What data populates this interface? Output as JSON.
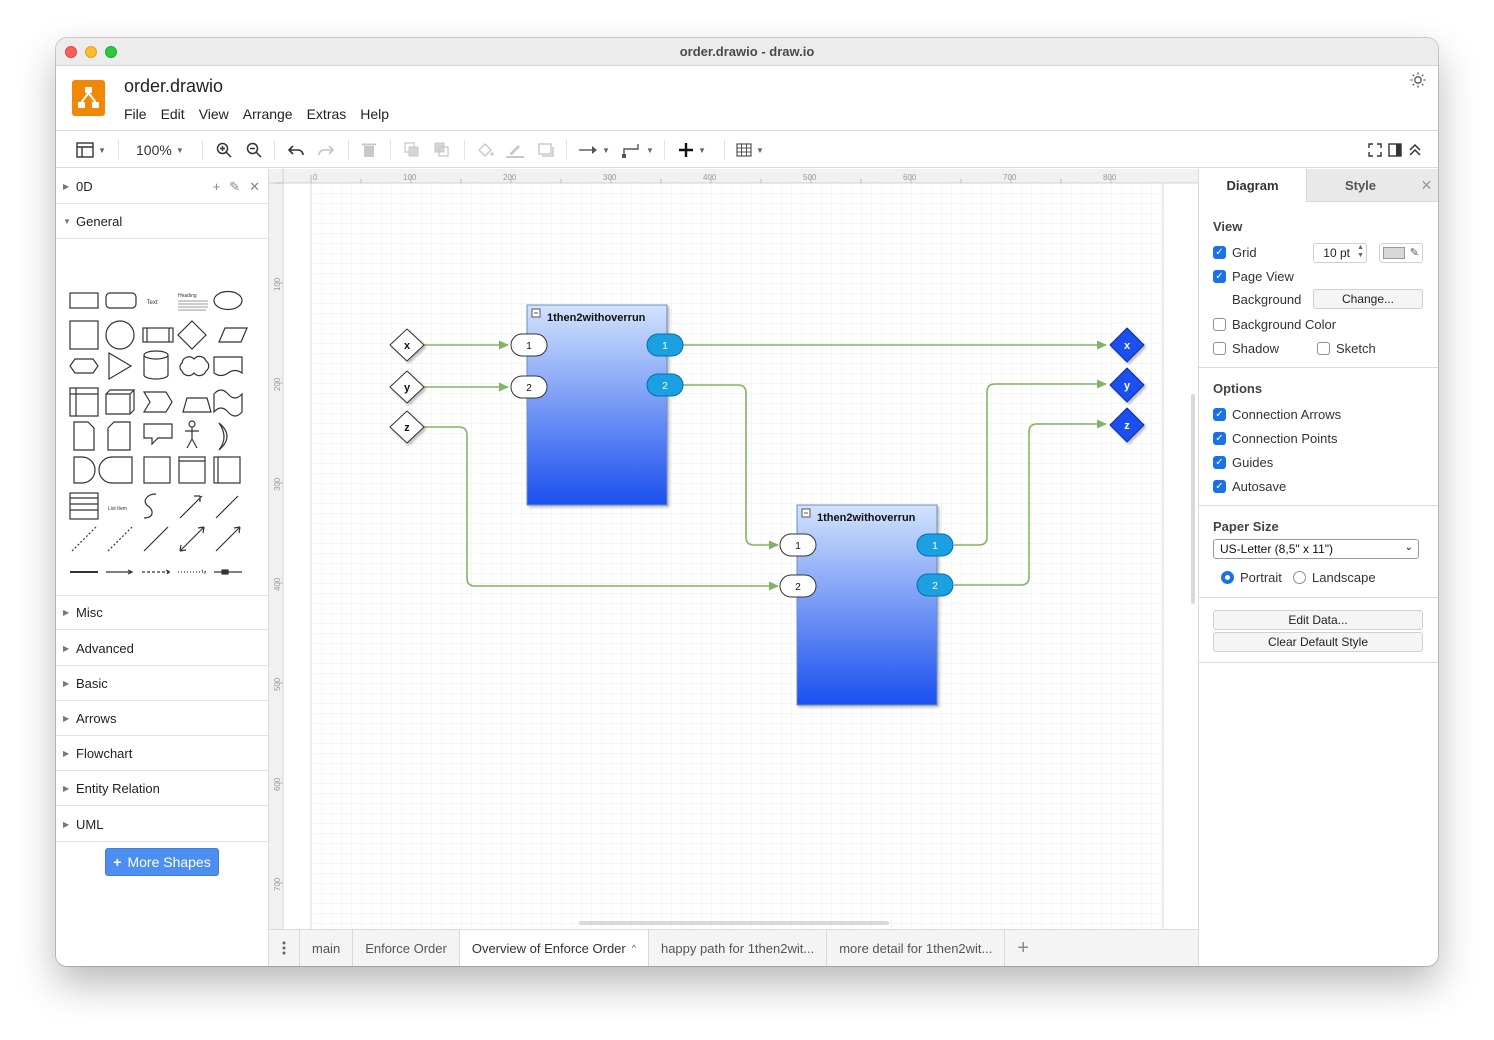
{
  "window": {
    "title": "order.drawio - draw.io"
  },
  "app": {
    "doc_title": "order.drawio"
  },
  "menu": [
    "File",
    "Edit",
    "View",
    "Arrange",
    "Extras",
    "Help"
  ],
  "toolbar": {
    "zoom": "100%"
  },
  "sidebar": {
    "scratchpad_label": "0D",
    "general_label": "General",
    "general_text_shape": "Text",
    "general_heading_shape": "Heading",
    "general_list_item": "List Item",
    "sections": [
      "Misc",
      "Advanced",
      "Basic",
      "Arrows",
      "Flowchart",
      "Entity Relation",
      "UML"
    ],
    "more_shapes": "More Shapes"
  },
  "canvas": {
    "ruler_top": [
      "0",
      "100",
      "200",
      "300",
      "400",
      "500",
      "600",
      "700",
      "800"
    ],
    "ruler_left": [
      "100",
      "200",
      "300",
      "400",
      "500",
      "600",
      "700"
    ],
    "block1": {
      "title": "1then2withoverrun",
      "in": [
        "1",
        "2"
      ],
      "out": [
        "1",
        "2"
      ]
    },
    "block2": {
      "title": "1then2withoverrun",
      "in": [
        "1",
        "2"
      ],
      "out": [
        "1",
        "2"
      ]
    },
    "inputs": [
      "x",
      "y",
      "z"
    ],
    "outputs": [
      "x",
      "y",
      "z"
    ],
    "colors": {
      "edge": "#82b366",
      "block_top": "#d2e3fc",
      "block_bottom": "#1a4fef",
      "port_out": "#1ba1e2",
      "output_node": "#1a4fef"
    }
  },
  "page_tabs": [
    {
      "label": "main"
    },
    {
      "label": "Enforce Order"
    },
    {
      "label": "Overview of Enforce Order"
    },
    {
      "label": "happy path for 1then2wit..."
    },
    {
      "label": "more detail for 1then2wit..."
    }
  ],
  "format": {
    "tab_diagram": "Diagram",
    "tab_style": "Style",
    "view_title": "View",
    "grid": "Grid",
    "grid_size": "10 pt",
    "page_view": "Page View",
    "background": "Background",
    "change": "Change...",
    "background_color": "Background Color",
    "shadow": "Shadow",
    "sketch": "Sketch",
    "options_title": "Options",
    "connection_arrows": "Connection Arrows",
    "connection_points": "Connection Points",
    "guides": "Guides",
    "autosave": "Autosave",
    "paper_title": "Paper Size",
    "paper_value": "US-Letter (8,5\" x 11\")",
    "portrait": "Portrait",
    "landscape": "Landscape",
    "edit_data": "Edit Data...",
    "clear_default_style": "Clear Default Style"
  }
}
